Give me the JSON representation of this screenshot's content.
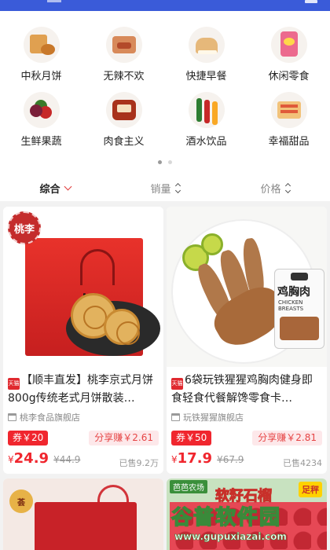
{
  "categories": [
    {
      "label": "中秋月饼",
      "icon": "mooncake-icon"
    },
    {
      "label": "无辣不欢",
      "icon": "spicy-food-icon"
    },
    {
      "label": "快捷早餐",
      "icon": "bread-icon"
    },
    {
      "label": "休闲零食",
      "icon": "snack-bag-icon"
    },
    {
      "label": "生鲜果蔬",
      "icon": "fruit-icon"
    },
    {
      "label": "肉食主义",
      "icon": "meat-icon"
    },
    {
      "label": "酒水饮品",
      "icon": "bottles-icon"
    },
    {
      "label": "幸福甜品",
      "icon": "dessert-box-icon"
    }
  ],
  "pager": {
    "pages": 2,
    "active": 1
  },
  "sort": {
    "options": [
      {
        "label": "综合",
        "active": true
      },
      {
        "label": "销量",
        "active": false
      },
      {
        "label": "价格",
        "active": false
      }
    ]
  },
  "products": [
    {
      "platform_badge": "天猫",
      "title": "【顺丰直发】桃李京式月饼800g传统老式月饼散装…",
      "shop": "桃李食品旗舰店",
      "coupon": "券￥20",
      "share": "分享赚￥2.61",
      "price_symbol": "¥",
      "price": "24.9",
      "original_price": "¥44.9",
      "sold": "已售9.2万",
      "image_logo": "桃李",
      "image_calligraphy": [
        "桃",
        "李"
      ]
    },
    {
      "platform_badge": "天猫",
      "title": "6袋玩铁猩猩鸡胸肉健身即食轻食代餐解馋零食卡…",
      "shop": "玩铁猩猩旗舰店",
      "coupon": "券￥50",
      "share": "分享赚￥2.81",
      "price_symbol": "¥",
      "price": "17.9",
      "original_price": "¥67.9",
      "sold": "已售4234",
      "package_title": "鸡胸肉",
      "package_sub": "CHICKEN BREASTS"
    },
    {
      "image_stamp": "荟"
    },
    {
      "brand_tag": "芭芭农场",
      "promo_text": "软籽石榴",
      "promo_badge": "足秤"
    }
  ],
  "watermark": {
    "main": "谷普软件园",
    "url": "www.gupuxiazai.com"
  },
  "colors": {
    "accent": "#f0262e",
    "header": "#3a5bd9",
    "share_bg": "#fde8ea"
  }
}
